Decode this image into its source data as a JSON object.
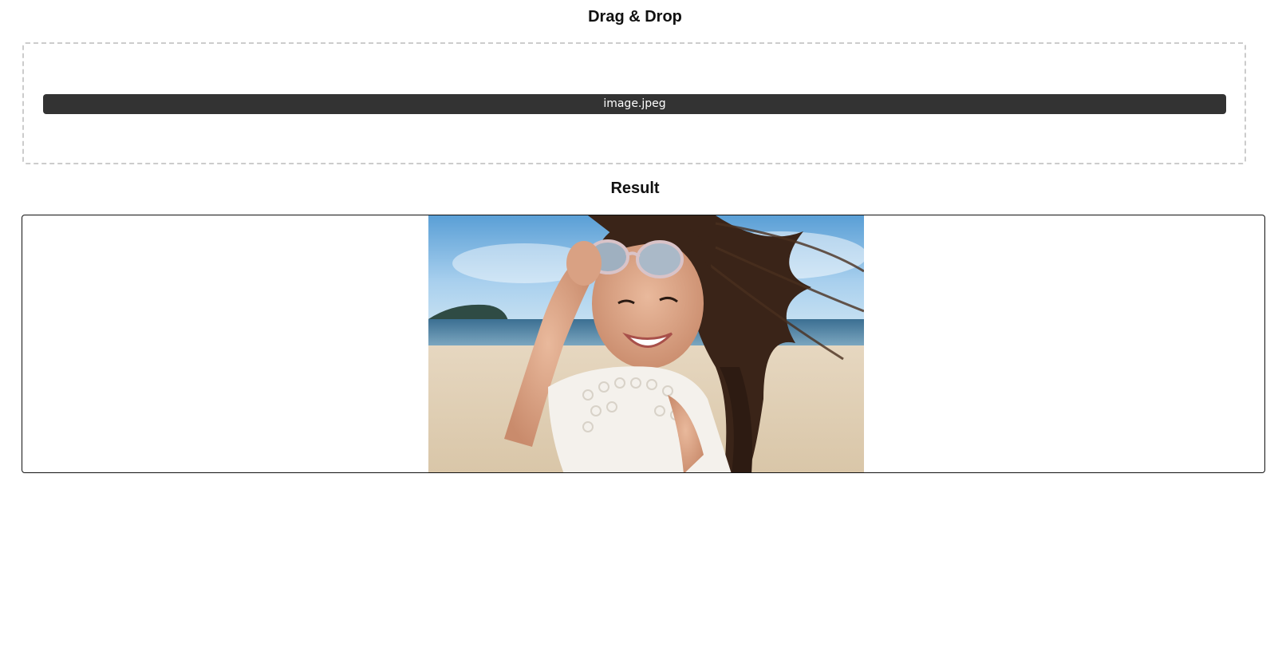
{
  "dragdrop": {
    "title": "Drag & Drop",
    "file_name": "image.jpeg"
  },
  "result": {
    "title": "Result",
    "image_alt": "Woman smiling on a beach, lifting sunglasses"
  }
}
